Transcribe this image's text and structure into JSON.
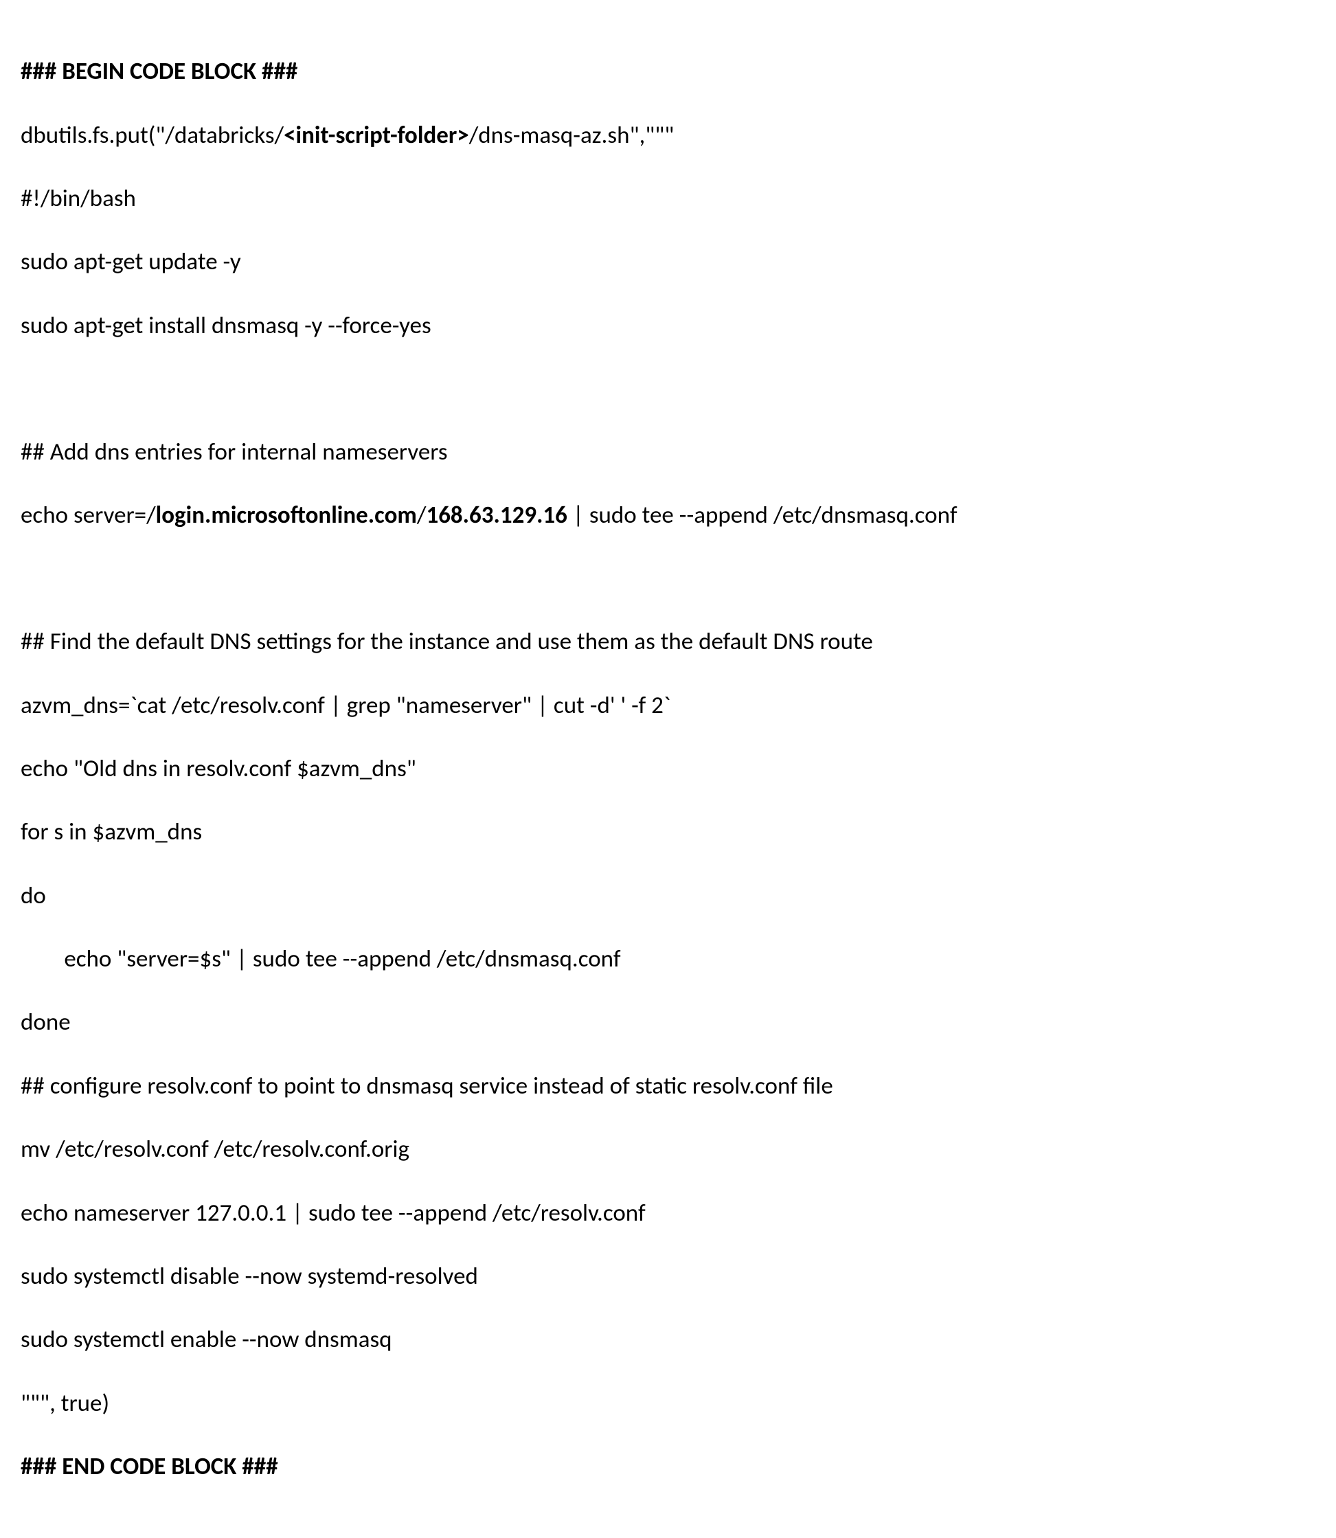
{
  "code": {
    "begin_marker": "### BEGIN CODE BLOCK ###",
    "line1_part1": "dbutils.fs.put(\"/databricks/",
    "line1_bold": "<init-script-folder>",
    "line1_part2": "/dns-masq-az.sh\",\"\"\"",
    "line2": "#!/bin/bash",
    "line3": "sudo apt-get update -y",
    "line4": "sudo apt-get install dnsmasq -y --force-yes",
    "line6": "## Add dns entries for internal nameservers",
    "line7_part1": "echo server=/",
    "line7_bold1": "login.microsoftonline.com",
    "line7_part2": "/",
    "line7_bold2": "168.63.129.16",
    "line7_part3": " | sudo tee --append /etc/dnsmasq.conf",
    "line9": "## Find the default DNS settings for the instance and use them as the default DNS route",
    "line10": "azvm_dns=`cat /etc/resolv.conf | grep \"nameserver\" | cut -d' ' -f 2`",
    "line11": "echo \"Old dns in resolv.conf $azvm_dns\"",
    "line12": "for s in $azvm_dns",
    "line13": "do",
    "line14": "        echo \"server=$s\" | sudo tee --append /etc/dnsmasq.conf",
    "line15": "done",
    "line16": "## configure resolv.conf to point to dnsmasq service instead of static resolv.conf file",
    "line17": "mv /etc/resolv.conf /etc/resolv.conf.orig",
    "line18": "echo nameserver 127.0.0.1 | sudo tee --append /etc/resolv.conf",
    "line19": "sudo systemctl disable --now systemd-resolved",
    "line20": "sudo systemctl enable --now dnsmasq",
    "line21": "\"\"\", true)",
    "end_marker": "### END CODE BLOCK ###"
  }
}
